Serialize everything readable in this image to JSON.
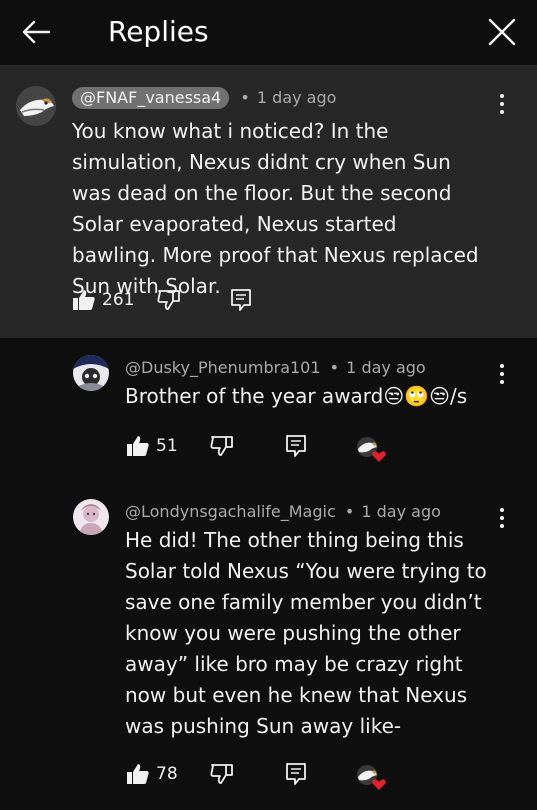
{
  "header": {
    "title": "Replies",
    "back_icon": "arrow-left-icon",
    "close_icon": "close-icon"
  },
  "comments": [
    {
      "author": "@FNAF_vanessa4",
      "time": "1 day ago",
      "text": "You know what i noticed? In the simulation, Nexus didnt cry when Sun was dead on the floor. But the second Solar evaporated, Nexus started bawling. More proof that Nexus replaced Sun with Solar.",
      "likes": "261"
    },
    {
      "author": "@Dusky_Phenumbra101",
      "time": "1 day ago",
      "text": "Brother of the year award",
      "emoji": "😒🙄😒",
      "suffix": "/s",
      "likes": "51"
    },
    {
      "author": "@Londynsgachalife_Magic",
      "time": "1 day ago",
      "text": "He did! The other thing being this Solar told Nexus “You were trying to save one family member you didn’t know you were pushing the other away” like bro may be crazy right now but even he knew that Nexus was pushing Sun away like-",
      "likes": "78"
    }
  ],
  "separator": "•",
  "colors": {
    "background": "#0f0f0f",
    "highlight_background": "#272727",
    "chip": "#717171",
    "meta_text": "#aaaaaa",
    "heart": "#e0202a"
  }
}
